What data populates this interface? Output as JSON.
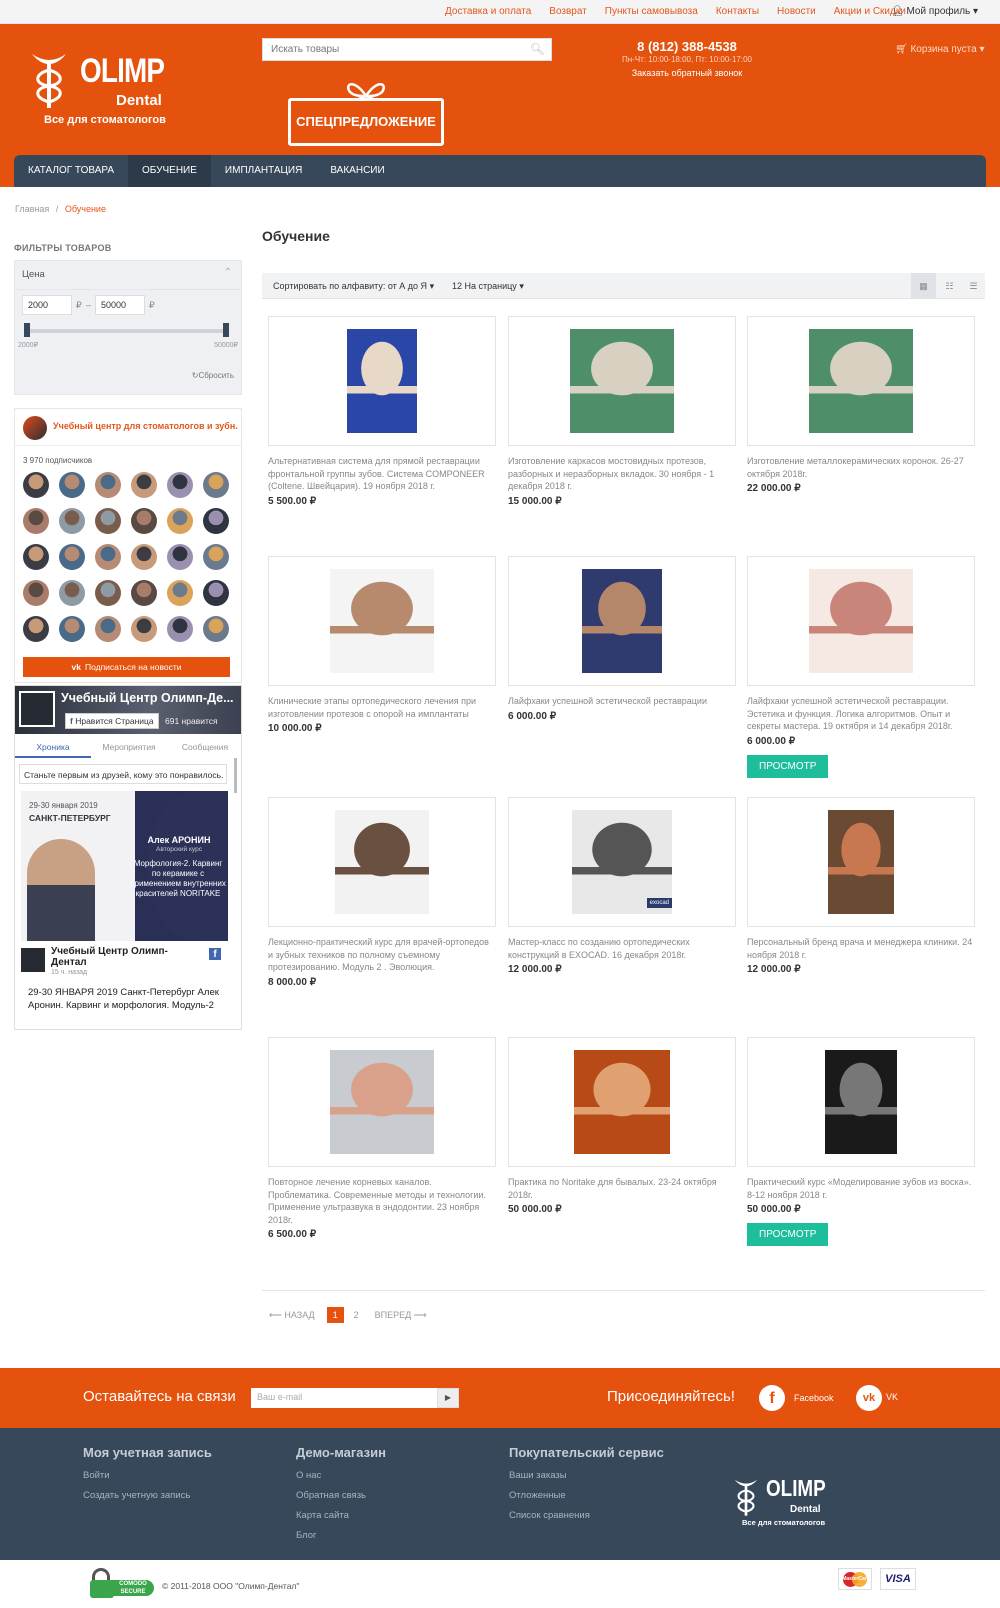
{
  "topbar": {
    "links": [
      "Доставка и оплата",
      "Возврат",
      "Пункты самовывоза",
      "Контакты",
      "Новости",
      "Акции и Скидки"
    ],
    "profile": "Мой профиль"
  },
  "header": {
    "logo_main": "OLIMP",
    "logo_sub": "Dental",
    "logo_tagline": "Все для стоматологов",
    "search_placeholder": "Искать товары",
    "promo": "СПЕЦПРЕДЛОЖЕНИЕ",
    "phone": "8 (812) 388-4538",
    "hours": "Пн-Чт: 10:00-18:00, Пт: 10:00-17:00",
    "callback": "Заказать обратный звонок",
    "cart": "Корзина пуста"
  },
  "nav": [
    "КАТАЛОГ ТОВАРА",
    "ОБУЧЕНИЕ",
    "ИМПЛАНТАЦИЯ",
    "ВАКАНСИИ"
  ],
  "breadcrumb": {
    "home": "Главная",
    "sep": "/",
    "current": "Обучение"
  },
  "filters": {
    "title": "ФИЛЬТРЫ ТОВАРОВ",
    "price_label": "Цена",
    "min": "2000",
    "max": "50000",
    "currency": "₽",
    "dash": "–",
    "min_label": "2000₽",
    "max_label": "50000₽",
    "reset": "Сбросить"
  },
  "vk": {
    "name": "Учебный центр для стоматологов и зубн...",
    "subscribers": "3 970 подписчиков",
    "subscribe": "Подписаться на новости"
  },
  "fb": {
    "page": "Учебный Центр Олимп-Де...",
    "like": "Нравится Страница",
    "likes": "691 нравится",
    "tabs": [
      "Хроника",
      "Мероприятия",
      "Сообщения"
    ],
    "first_friends": "Станьте первым из друзей, кому это понравилось.",
    "post_date": "29-30 января 2019",
    "post_city": "САНКТ-ПЕТЕРБУРГ",
    "post_name": "Алек АРОНИН",
    "post_role": "Авторский курс",
    "post_course": "Морфология-2. Карвинг по керамике с применением внутренних красителей NORITAKE",
    "author": "Учебный Центр Олимп-Дентал",
    "time": "15 ч. назад",
    "text": "29-30 ЯНВАРЯ 2019 Санкт-Петербург Алек Аронин. Карвинг и морфология. Модуль-2"
  },
  "main": {
    "heading": "Обучение",
    "sort": "Сортировать по алфавиту: от А до Я",
    "per_page": "12 На страницу"
  },
  "products": [
    {
      "desc": "Альтернативная система для прямой реставрации фронтальной группы зубов. Система COMPONEER (Coltene. Швейцария). 19 ноября 2018 г.",
      "price": "5 500.00 ₽"
    },
    {
      "desc": "Изготовление каркасов мостовидных протезов, разборных и неразборных вкладок. 30 ноября - 1 декабря 2018 г.",
      "price": "15 000.00 ₽"
    },
    {
      "desc": "Изготовление металлокерамических коронок. 26-27 октября 2018г.",
      "price": "22 000.00 ₽"
    },
    {
      "desc": "Клинические этапы ортопедического лечения при изготовлении протезов с опорой на имплантаты",
      "price": "10 000.00 ₽"
    },
    {
      "desc": "Лайфхаки успешной эстетической реставрации",
      "price": "6 000.00 ₽"
    },
    {
      "desc": "Лайфхаки успешной эстетической реставрации. Эстетика и функция. Логика алгоритмов. Опыт и секреты мастера. 19 октября и 14 декабря 2018г.",
      "price": "6 000.00 ₽",
      "button": "ПРОСМОТР"
    },
    {
      "desc": "Лекционно-практический курс для врачей-ортопедов и зубных техников по полному съемному протезированию. Модуль 2 . Эволюция.",
      "price": "8 000.00 ₽"
    },
    {
      "desc": "Мастер-класс по созданию ортопедических конструкций в EXOCAD. 16 декабря 2018г.",
      "price": "12 000.00 ₽",
      "badge": "exocad"
    },
    {
      "desc": "Персональный бренд врача и менеджера клиники. 24 ноября 2018 г.",
      "price": "12 000.00 ₽"
    },
    {
      "desc": "Повторное лечение корневых каналов. Проблематика. Современные методы и технологии. Применение ультразвука в эндодонтии. 23 ноября 2018г.",
      "price": "6 500.00 ₽"
    },
    {
      "desc": "Практика по Noritake для бывалых. 23-24 октября 2018г.",
      "price": "50 000.00 ₽"
    },
    {
      "desc": "Практический курс «Моделирование зубов из воска». 8-12 ноября 2018 г.",
      "price": "50 000.00 ₽",
      "button": "ПРОСМОТР"
    }
  ],
  "pager": {
    "prev": "⟵ НАЗАД",
    "pages": [
      "1",
      "2"
    ],
    "next": "ВПЕРЕД ⟶"
  },
  "newsletter": {
    "title": "Оставайтесь на связи",
    "placeholder": "Ваш e-mail",
    "join": "Присоединяйтесь!",
    "facebook": "Facebook",
    "vk": "VK"
  },
  "footer": {
    "col1_title": "Моя учетная запись",
    "col1": [
      "Войти",
      "Создать учетную запись"
    ],
    "col2_title": "Демо-магазин",
    "col2": [
      "О нас",
      "Обратная связь",
      "Карта сайта",
      "Блог"
    ],
    "col3_title": "Покупательский сервис",
    "col3": [
      "Ваши заказы",
      "Отложенные",
      "Список сравнения"
    ],
    "copyright": "© 2011-2018 ООО \"Олимп-Дентал\"",
    "comodo": "COMODO SECURE",
    "visa": "VISA",
    "mastercard": "MasterCard"
  },
  "colors": {
    "brand": "#e4520d",
    "nav": "#37485a",
    "accent_button": "#1ebe9c"
  }
}
